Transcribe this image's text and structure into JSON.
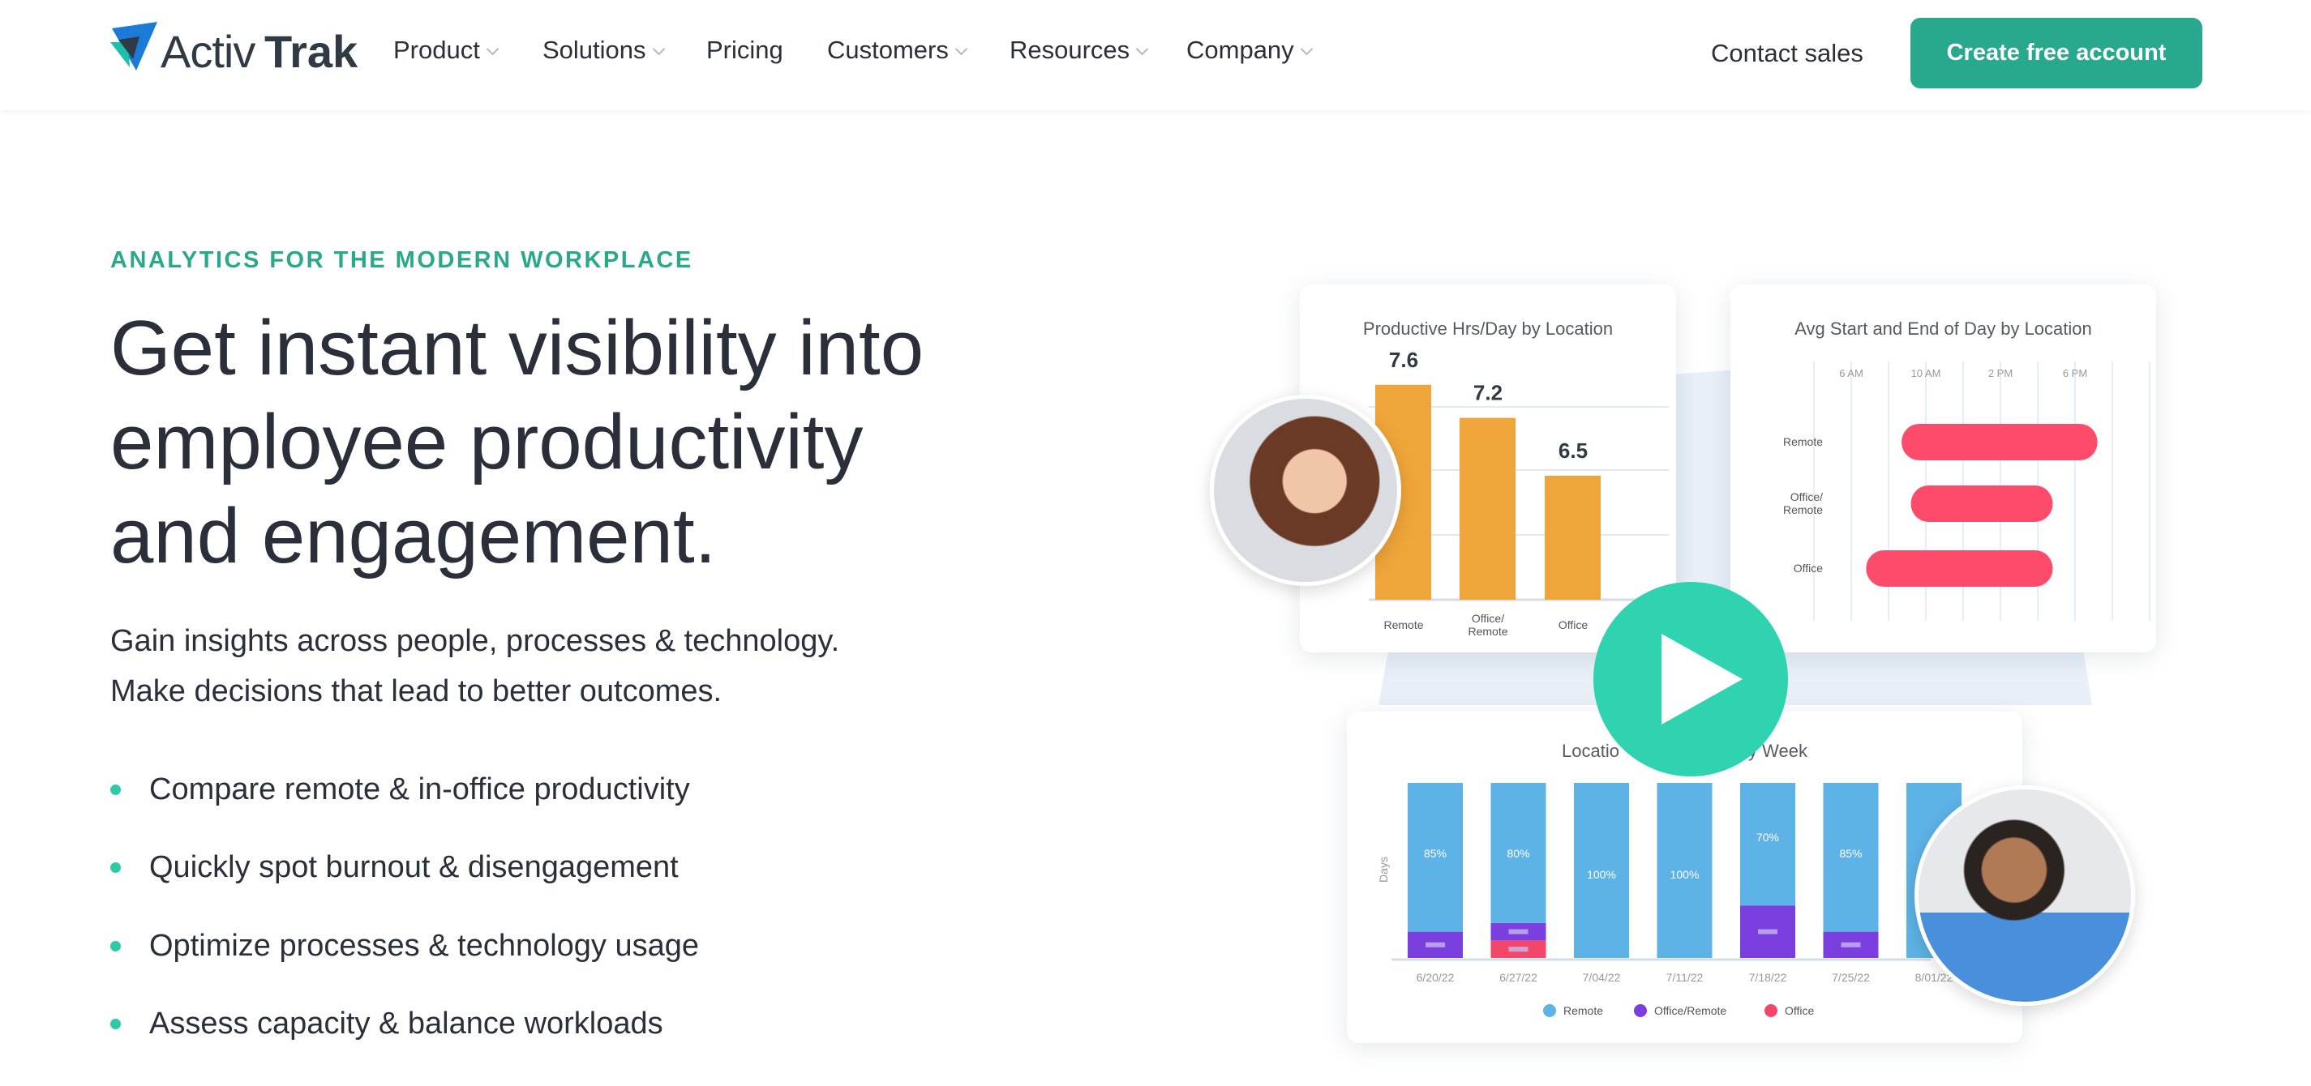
{
  "brand": {
    "logo_light": "Activ",
    "logo_bold": "Trak",
    "colors": {
      "blue": "#1a7bd8",
      "teal": "#1fbfad",
      "dark": "#2f3a44"
    }
  },
  "nav": {
    "items": [
      {
        "label": "Product",
        "dropdown": true
      },
      {
        "label": "Solutions",
        "dropdown": true
      },
      {
        "label": "Pricing",
        "dropdown": false
      },
      {
        "label": "Customers",
        "dropdown": true
      },
      {
        "label": "Resources",
        "dropdown": true
      },
      {
        "label": "Company",
        "dropdown": true
      }
    ],
    "contact": "Contact sales",
    "cta": "Create free account",
    "cta_color": "#28a98e"
  },
  "hero": {
    "eyebrow": "ANALYTICS FOR THE MODERN WORKPLACE",
    "headline": [
      "Get instant visibility into",
      "employee productivity",
      "and engagement."
    ],
    "subtitle": [
      "Gain insights across people, processes & technology.",
      "Make decisions that lead to better outcomes."
    ],
    "bullets": [
      "Compare remote & in-office productivity",
      "Quickly spot burnout & disengagement",
      "Optimize processes & technology usage",
      "Assess capacity & balance workloads"
    ],
    "accent": "#2ba88a"
  },
  "media": {
    "play_icon": "play-icon",
    "play_color": "#2fd3b0"
  },
  "chart_data": [
    {
      "type": "bar",
      "title": "Productive Hrs/Day by Location",
      "categories": [
        "Remote",
        "Office/\nRemote",
        "Office"
      ],
      "values": [
        7.6,
        7.2,
        6.5
      ],
      "color": "#f0a53a",
      "grid": true
    },
    {
      "type": "bar",
      "orientation": "horizontal-range",
      "title": "Avg Start and End of Day by Location",
      "x_ticks": [
        "6 AM",
        "10 AM",
        "2 PM",
        "6 PM"
      ],
      "categories": [
        "Remote",
        "Office/\nRemote",
        "Office"
      ],
      "ranges_hours": [
        [
          8.7,
          19.2
        ],
        [
          9.2,
          16.8
        ],
        [
          6.8,
          16.8
        ]
      ],
      "color": "#ff4b6b",
      "grid": true
    },
    {
      "type": "bar",
      "stacked": true,
      "title_left": "Locatio",
      "title_right": "y Week",
      "ylabel": "Days",
      "categories": [
        "6/20/22",
        "6/27/22",
        "7/04/22",
        "7/11/22",
        "7/18/22",
        "7/25/22",
        "8/01/22"
      ],
      "series": [
        {
          "name": "Remote",
          "color": "#5db2e6",
          "values": [
            85,
            80,
            100,
            100,
            70,
            85,
            100
          ],
          "labels": [
            "85%",
            "80%",
            "100%",
            "100%",
            "70%",
            "85%",
            ""
          ]
        },
        {
          "name": "Office/Remote",
          "color": "#7b3fe0",
          "values": [
            15,
            10,
            0,
            0,
            30,
            15,
            0
          ]
        },
        {
          "name": "Office",
          "color": "#f2476a",
          "values": [
            0,
            10,
            0,
            0,
            0,
            0,
            0
          ]
        }
      ],
      "legend": "bottom"
    }
  ]
}
